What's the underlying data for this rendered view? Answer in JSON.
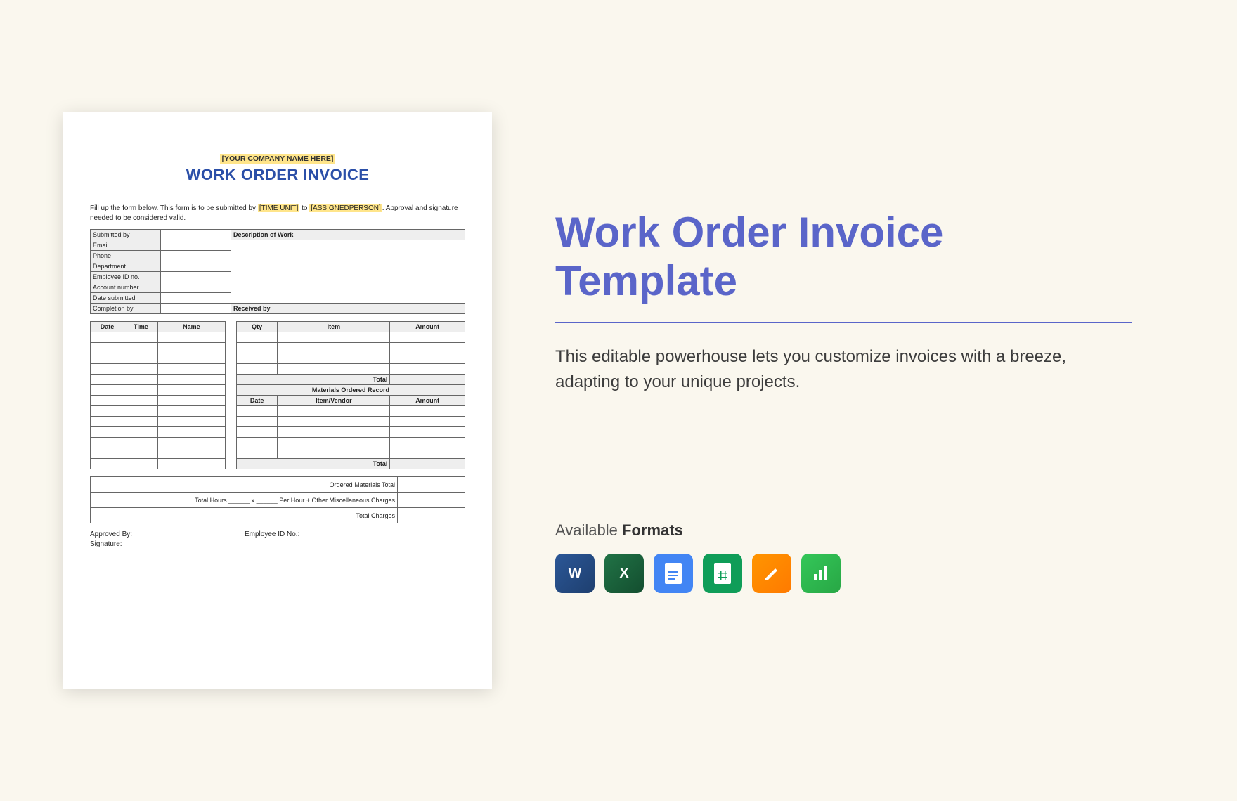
{
  "doc": {
    "company_placeholder": "[YOUR COMPANY NAME HERE]",
    "title": "WORK ORDER INVOICE",
    "instructions_prefix": "Fill up the form below. This form is to be submitted by ",
    "time_unit": "[TIME UNIT]",
    "inst_to": " to ",
    "assigned_person": "[ASSIGNEDPERSON]",
    "instructions_suffix": ". Approval and signature needed to be considered valid.",
    "info_rows": [
      "Submitted by",
      "Email",
      "Phone",
      "Department",
      "Employee ID no.",
      "Account number",
      "Date submitted",
      "Completion by"
    ],
    "desc_header": "Description of Work",
    "received_by": "Received by",
    "cols_left": [
      "Date",
      "Time",
      "Name"
    ],
    "cols_right": [
      "Qty",
      "Item",
      "Amount"
    ],
    "total_label": "Total",
    "materials_header": "Materials Ordered Record",
    "materials_cols": [
      "Date",
      "Item/Vendor",
      "Amount"
    ],
    "ordered_total": "Ordered Materials Total",
    "hours_line": "Total Hours ______ x ______ Per Hour + Other Miscellaneous Charges",
    "total_charges": "Total Charges",
    "approved_by": "Approved By:",
    "emp_id": "Employee ID No.:",
    "signature": "Signature:"
  },
  "panel": {
    "title": "Work Order Invoice Template",
    "description": "This editable powerhouse lets you customize invoices with a breeze, adapting to your unique projects.",
    "formats_prefix": "Available ",
    "formats_strong": "Formats",
    "icons": [
      "word",
      "excel",
      "gdocs",
      "gsheets",
      "pages",
      "numbers"
    ]
  }
}
